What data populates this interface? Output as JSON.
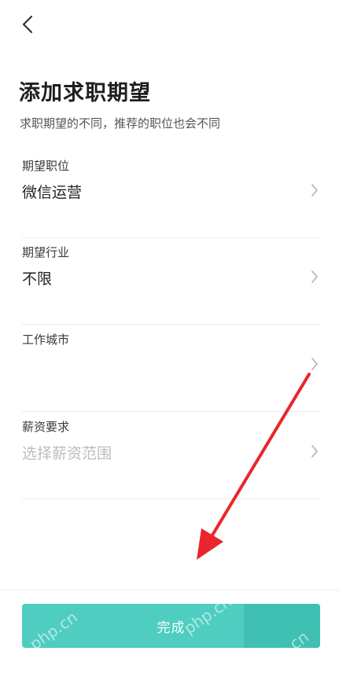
{
  "header": {
    "back_icon": "chevron-left-icon"
  },
  "page": {
    "title": "添加求职期望",
    "subtitle": "求职期望的不同，推荐的职位也会不同"
  },
  "form": {
    "rows": [
      {
        "label": "期望职位",
        "value": "微信运营",
        "placeholder": ""
      },
      {
        "label": "期望行业",
        "value": "不限",
        "placeholder": ""
      },
      {
        "label": "工作城市",
        "value": "",
        "placeholder": ""
      },
      {
        "label": "薪资要求",
        "value": "",
        "placeholder": "选择薪资范围"
      }
    ],
    "row_icon": "chevron-right-icon"
  },
  "footer": {
    "done_label": "完成"
  },
  "watermark": {
    "text_1": "php.cn",
    "text_2": "php.cn",
    "text_3": "php.cn"
  },
  "colors": {
    "accent": "#4ecdc0",
    "arrow": "#e8262b",
    "placeholder": "#bdbdbd"
  }
}
